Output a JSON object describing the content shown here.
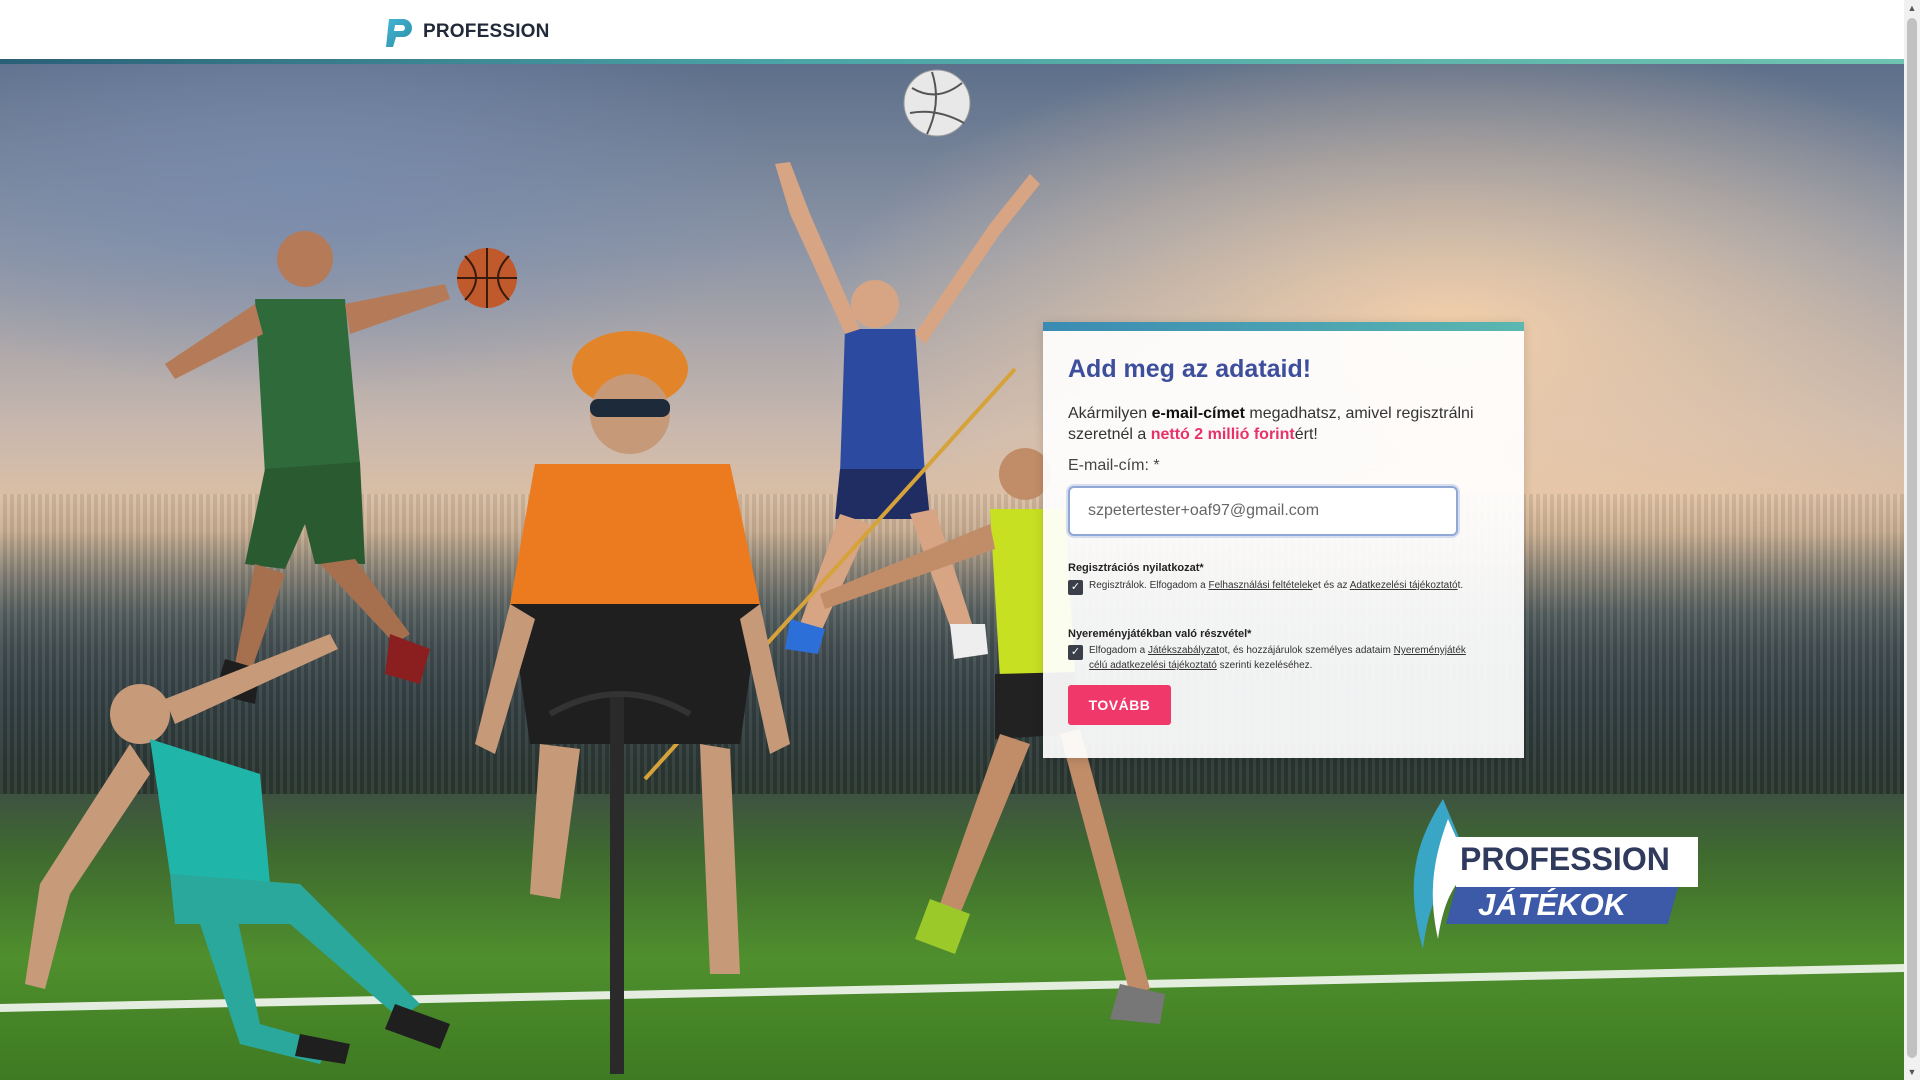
{
  "header": {
    "logo_text": "PROFESSION",
    "accent_color": "#2a5f78"
  },
  "card": {
    "title": "Add meg az adataid!",
    "lead": {
      "part1": "Akármilyen ",
      "bold": "e-mail-címet",
      "part2": " megadhatsz, amivel regisztrálni szeretnél a ",
      "highlight": "nettó 2 millió forint",
      "part3": "ért!"
    },
    "email_label": "E-mail-cím: *",
    "email_value": "szpetertester+oaf97@gmail.com",
    "registration": {
      "title": "Regisztrációs nyilatkozat*",
      "checked": true,
      "text1": "Regisztrálok. Elfogadom a ",
      "link1": "Felhasználási feltételek",
      "text2": "et és az ",
      "link2": "Adatkezelési tájékoztató",
      "text3": "t."
    },
    "contest": {
      "title": "Nyereményjátékban való részvétel*",
      "checked": true,
      "text1": "Elfogadom a ",
      "link1": "Játékszabályzat",
      "text2": "ot, és hozzájárulok személyes adataim ",
      "link2": "Nyereményjáték célú adatkezelési tájékoztató",
      "text3": " szerinti kezeléséhez."
    },
    "submit_label": "TOVÁBB",
    "highlight_color": "#e8316b",
    "title_color": "#3d4e9c"
  },
  "badge": {
    "line1": "PROFESSION",
    "line2": "JÁTÉKOK"
  }
}
